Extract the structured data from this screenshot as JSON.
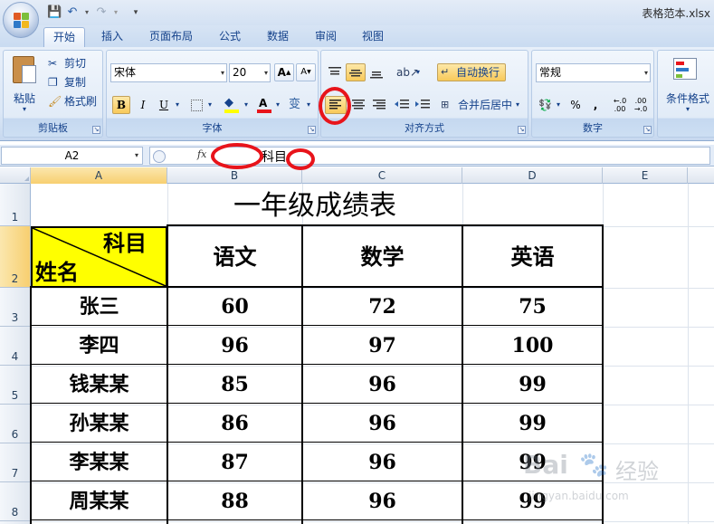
{
  "window": {
    "title": "表格范本.xlsx"
  },
  "tabs": [
    "开始",
    "插入",
    "页面布局",
    "公式",
    "数据",
    "审阅",
    "视图"
  ],
  "ribbon": {
    "clipboard": {
      "label": "剪贴板",
      "paste": "粘贴",
      "cut": "剪切",
      "copy": "复制",
      "format_painter": "格式刷"
    },
    "font": {
      "label": "字体",
      "name": "宋体",
      "size": "20",
      "bold": "B",
      "italic": "I",
      "underline": "U",
      "grow": "A",
      "shrink": "A"
    },
    "alignment": {
      "label": "对齐方式",
      "wrap": "自动换行",
      "merge": "合并后居中"
    },
    "number": {
      "label": "数字",
      "format": "常规",
      "percent": "%",
      "comma": ","
    },
    "styles": {
      "conditional": "条件格式"
    }
  },
  "formula_bar": {
    "name_box": "A2",
    "fx": "fx",
    "content": "科目"
  },
  "columns": [
    "A",
    "B",
    "C",
    "D",
    "E"
  ],
  "rows": [
    "1",
    "2",
    "3",
    "4",
    "5",
    "6",
    "7",
    "8"
  ],
  "sheet": {
    "title": "一年级成绩表",
    "header_top_right": "科目",
    "header_bottom_left": "姓名",
    "subjects": [
      "语文",
      "数学",
      "英语"
    ],
    "students": [
      {
        "name": "张三",
        "scores": [
          "60",
          "72",
          "75"
        ]
      },
      {
        "name": "李四",
        "scores": [
          "96",
          "97",
          "100"
        ]
      },
      {
        "name": "钱某某",
        "scores": [
          "85",
          "96",
          "99"
        ]
      },
      {
        "name": "孙某某",
        "scores": [
          "86",
          "96",
          "99"
        ]
      },
      {
        "name": "李某某",
        "scores": [
          "87",
          "96",
          "99"
        ]
      },
      {
        "name": "周某某",
        "scores": [
          "88",
          "96",
          "99"
        ]
      }
    ]
  },
  "watermark": {
    "brand": "Bai",
    "brand2": "经验",
    "url": "jingyan.baidu.com"
  },
  "colors": {
    "header_fill": "#ffff00",
    "highlight": "#e8141b",
    "ribbon": "#dbe7f6"
  }
}
